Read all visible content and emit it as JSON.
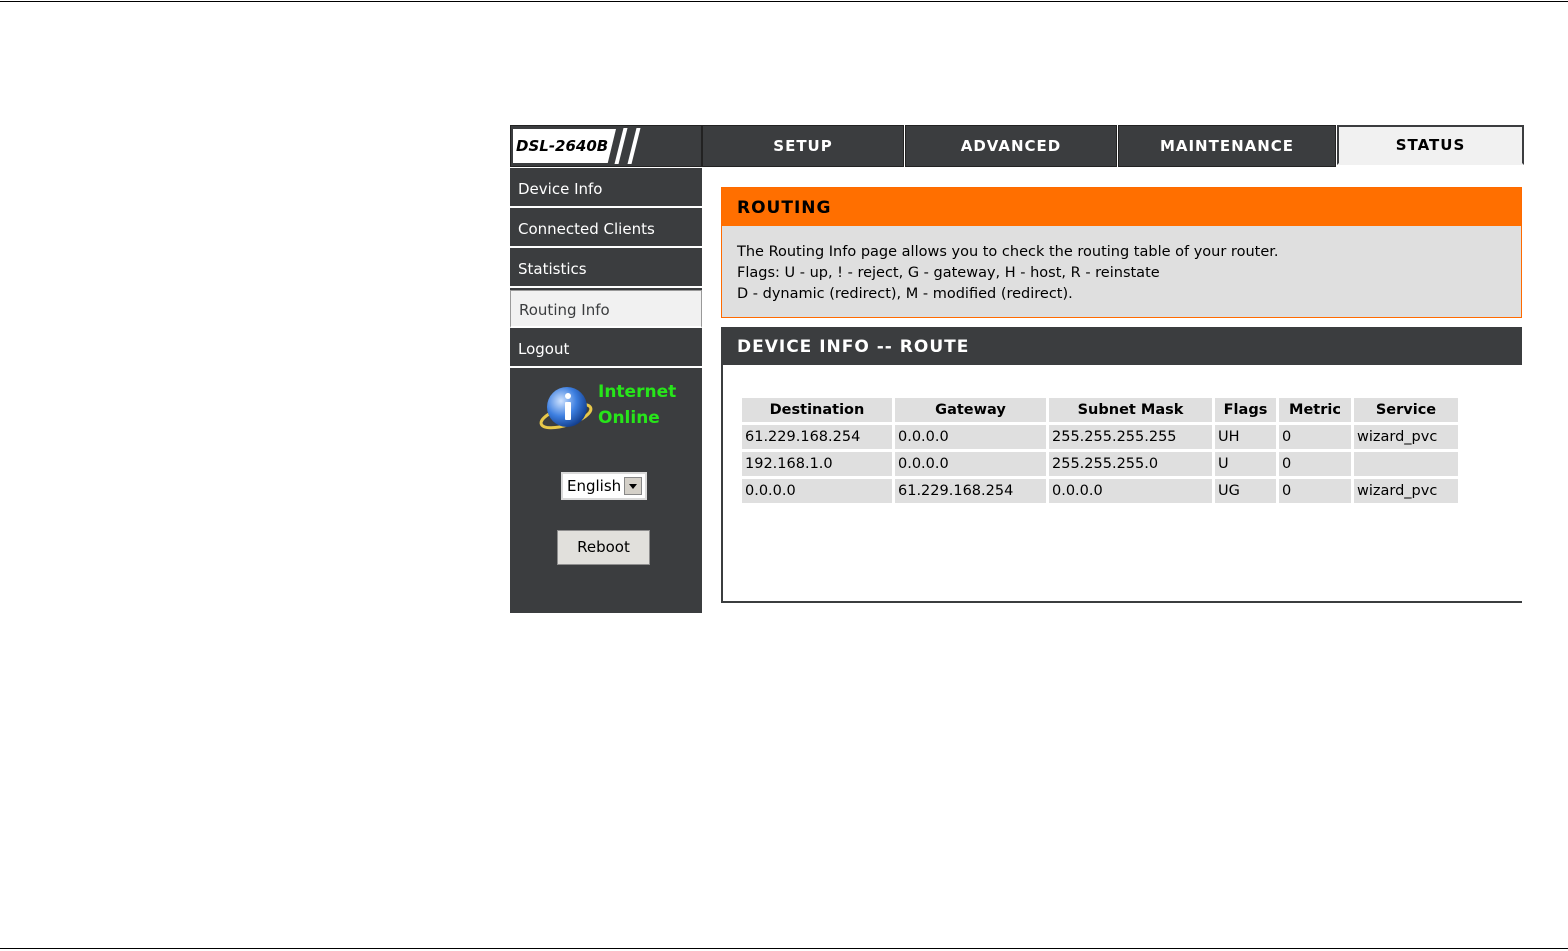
{
  "header": {
    "model": "DSL-2640B",
    "tabs": [
      {
        "label": "SETUP",
        "active": false
      },
      {
        "label": "ADVANCED",
        "active": false
      },
      {
        "label": "MAINTENANCE",
        "active": false
      },
      {
        "label": "STATUS",
        "active": true
      }
    ]
  },
  "sidebar": {
    "items": [
      {
        "label": "Device Info",
        "active": false
      },
      {
        "label": "Connected Clients",
        "active": false
      },
      {
        "label": "Statistics",
        "active": false
      },
      {
        "label": "Routing Info",
        "active": true
      },
      {
        "label": "Logout",
        "active": false
      }
    ],
    "internet_status_line1": "Internet",
    "internet_status_line2": "Online",
    "status_icon": "globe-info-icon",
    "language_select": {
      "selected": "English"
    },
    "reboot_label": "Reboot"
  },
  "routing": {
    "title": "ROUTING",
    "description": [
      "The Routing Info page allows you to check the routing table of your router.",
      "Flags: U - up, ! - reject, G - gateway, H - host, R - reinstate",
      "D - dynamic (redirect), M - modified (redirect)."
    ]
  },
  "route_table": {
    "title": "DEVICE INFO -- ROUTE",
    "columns": [
      "Destination",
      "Gateway",
      "Subnet Mask",
      "Flags",
      "Metric",
      "Service"
    ],
    "rows": [
      [
        "61.229.168.254",
        "0.0.0.0",
        "255.255.255.255",
        "UH",
        "0",
        "wizard_pvc"
      ],
      [
        "192.168.1.0",
        "0.0.0.0",
        "255.255.255.0",
        "U",
        "0",
        ""
      ],
      [
        "0.0.0.0",
        "61.229.168.254",
        "0.0.0.0",
        "UG",
        "0",
        "wizard_pvc"
      ]
    ]
  },
  "colors": {
    "nav_dark": "#3b3d3f",
    "accent_orange": "#ff6f00",
    "status_green": "#27e51a",
    "panel_gray": "#dfdfdf"
  }
}
